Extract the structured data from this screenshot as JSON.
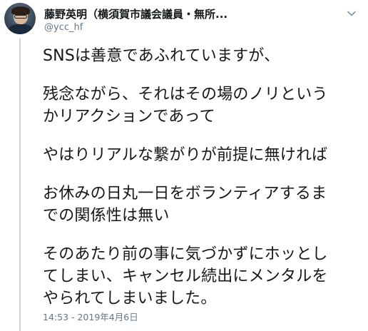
{
  "author": {
    "display_name": "藤野英明（横須賀市議会議員・無所...",
    "handle": "@ycc_hf"
  },
  "tweet": {
    "paragraphs": [
      [
        "SNSは善意であふれていますが、"
      ],
      [
        "残念ながら、それはその場のノリという",
        "かリアクションであって"
      ],
      [
        "やはりリアルな繋がりが前提に無ければ"
      ],
      [
        "お休みの日丸一日をボランティアするま",
        "での関係性は無い"
      ],
      [
        "そのあたり前の事に気づかずにホッとし",
        "てしまい、キャンセル続出にメンタルを",
        "やられてしまいました。"
      ]
    ],
    "timestamp": "14:53 - 2019年4月6日"
  },
  "icons": {
    "avatar": "profile-photo",
    "menu": "chevron-down-icon"
  },
  "colors": {
    "text": "#14171a",
    "secondary": "#657786",
    "thread_line": "#cbd5dd"
  }
}
